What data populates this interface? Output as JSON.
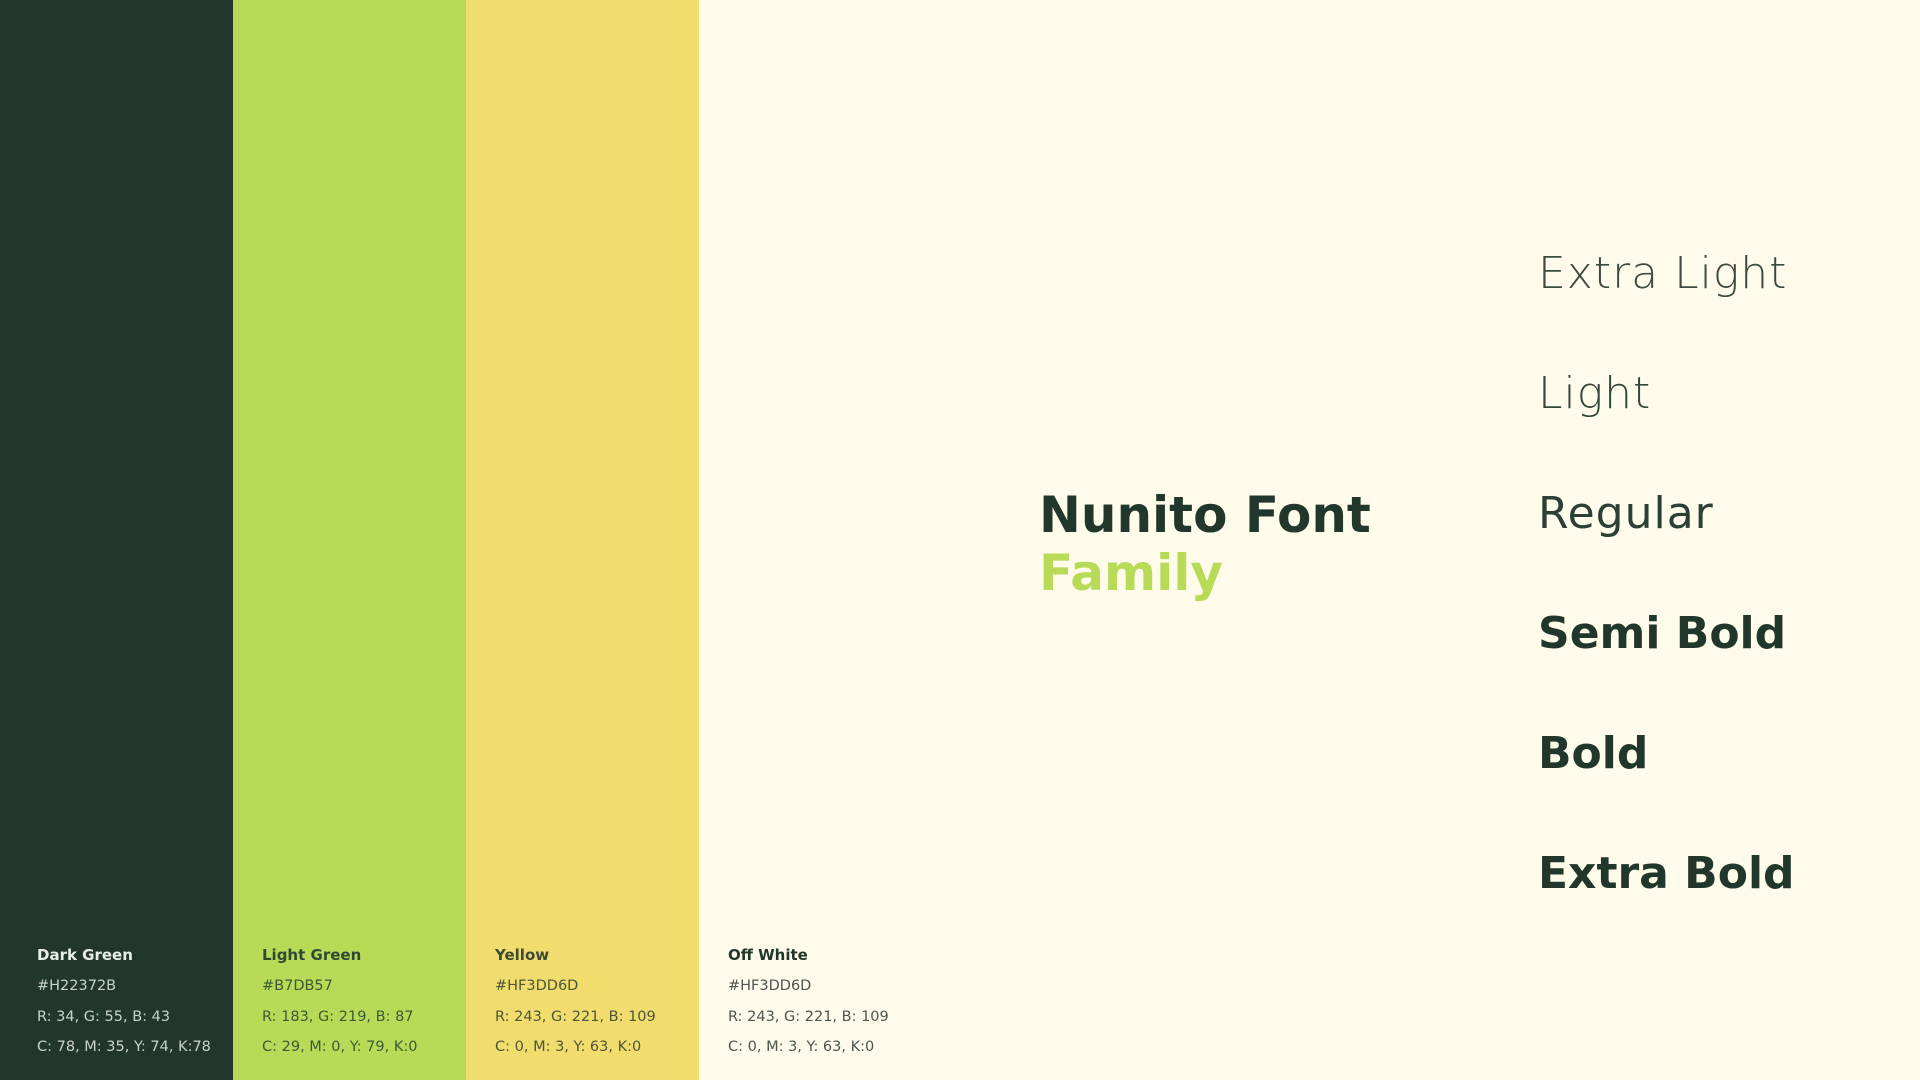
{
  "swatches": [
    {
      "name": "Dark Green",
      "hex": "#H22372B",
      "rgb": "R: 34, G: 55, B: 43",
      "cmyk": "C: 78, M: 35, Y: 74, K:78",
      "color": "#22372B"
    },
    {
      "name": "Light Green",
      "hex": "#B7DB57",
      "rgb": "R: 183, G: 219, B: 87",
      "cmyk": "C: 29, M: 0, Y: 79, K:0",
      "color": "#B7DB57"
    },
    {
      "name": "Yellow",
      "hex": "#HF3DD6D",
      "rgb": "R: 243, G: 221, B: 109",
      "cmyk": "C: 0, M: 3, Y: 63, K:0",
      "color": "#F1DD6E"
    },
    {
      "name": "Off White",
      "hex": "#HF3DD6D",
      "rgb": "R: 243, G: 221, B: 109",
      "cmyk": "C: 0, M: 3, Y: 63, K:0",
      "color": "#FEFBEA"
    }
  ],
  "font_family": {
    "title_line1": "Nunito Font",
    "title_line2": "Family"
  },
  "weights": [
    "Extra Light",
    "Light",
    "Regular",
    "Semi Bold",
    "Bold",
    "Extra Bold"
  ],
  "colors": {
    "dark_green": "#22372B",
    "light_green": "#B7DB57",
    "yellow": "#F1DD6E",
    "off_white": "#FEFBEA"
  }
}
